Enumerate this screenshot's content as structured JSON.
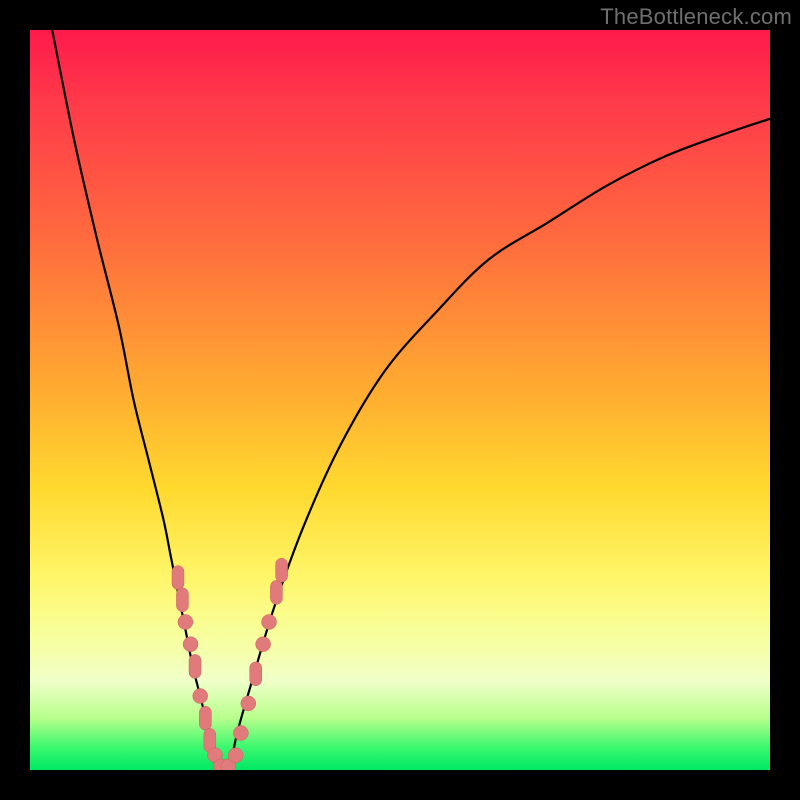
{
  "watermark": "TheBottleneck.com",
  "colors": {
    "curve": "#000000",
    "marker_fill": "#e17a7a",
    "marker_stroke": "#c96161"
  },
  "chart_data": {
    "type": "line",
    "title": "",
    "xlabel": "",
    "ylabel": "",
    "xlim": [
      0,
      100
    ],
    "ylim": [
      0,
      100
    ],
    "series": [
      {
        "name": "left-branch",
        "x": [
          3,
          6,
          9,
          12,
          14,
          16,
          18,
          19,
          20,
          21,
          22,
          23,
          24,
          25,
          26
        ],
        "y": [
          100,
          85,
          72,
          60,
          50,
          42,
          34,
          29,
          24,
          19,
          14,
          10,
          6,
          3,
          0
        ]
      },
      {
        "name": "right-branch",
        "x": [
          27,
          28,
          30,
          33,
          37,
          42,
          48,
          55,
          62,
          70,
          78,
          86,
          94,
          100
        ],
        "y": [
          0,
          5,
          12,
          22,
          33,
          44,
          54,
          62,
          69,
          74,
          79,
          83,
          86,
          88
        ]
      }
    ],
    "markers": {
      "name": "highlighted-points",
      "points": [
        {
          "x": 20.0,
          "y": 26,
          "shape": "vcap"
        },
        {
          "x": 20.6,
          "y": 23,
          "shape": "vcap"
        },
        {
          "x": 21.0,
          "y": 20,
          "shape": "round"
        },
        {
          "x": 21.7,
          "y": 17,
          "shape": "round"
        },
        {
          "x": 22.3,
          "y": 14,
          "shape": "vcap"
        },
        {
          "x": 23.0,
          "y": 10,
          "shape": "round"
        },
        {
          "x": 23.7,
          "y": 7,
          "shape": "vcap"
        },
        {
          "x": 24.3,
          "y": 4,
          "shape": "vcap"
        },
        {
          "x": 25.0,
          "y": 2,
          "shape": "round"
        },
        {
          "x": 25.8,
          "y": 0.5,
          "shape": "round"
        },
        {
          "x": 26.8,
          "y": 0.5,
          "shape": "round"
        },
        {
          "x": 27.8,
          "y": 2,
          "shape": "round"
        },
        {
          "x": 28.5,
          "y": 5,
          "shape": "round"
        },
        {
          "x": 29.5,
          "y": 9,
          "shape": "round"
        },
        {
          "x": 30.5,
          "y": 13,
          "shape": "vcap"
        },
        {
          "x": 31.5,
          "y": 17,
          "shape": "round"
        },
        {
          "x": 32.3,
          "y": 20,
          "shape": "round"
        },
        {
          "x": 33.3,
          "y": 24,
          "shape": "vcap"
        },
        {
          "x": 34.0,
          "y": 27,
          "shape": "vcap"
        }
      ]
    }
  }
}
